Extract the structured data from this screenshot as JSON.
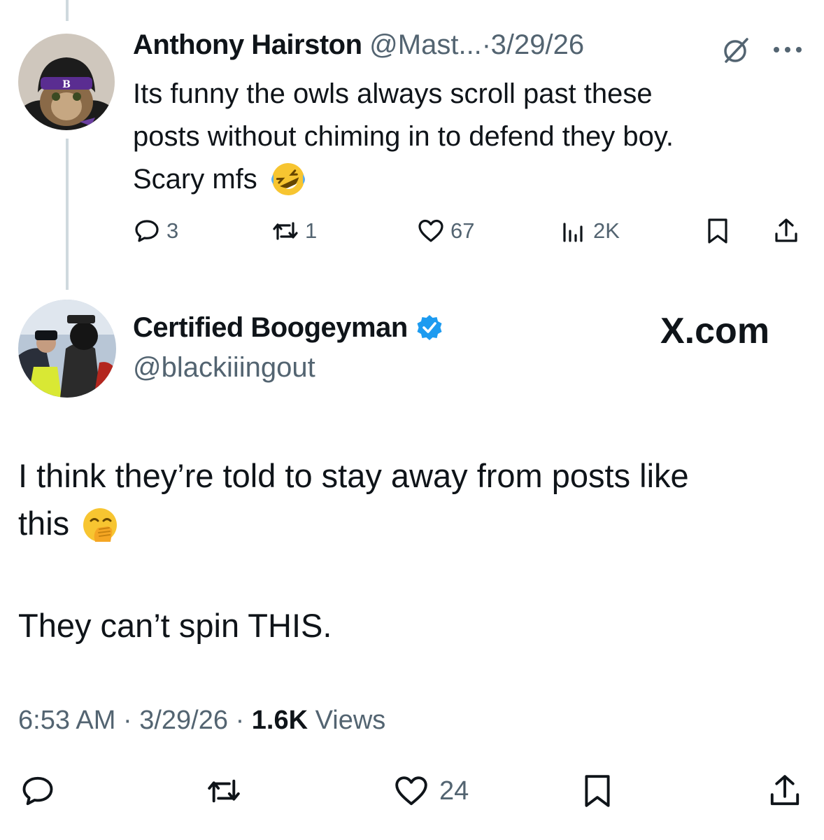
{
  "reply": {
    "author_name": "Anthony Hairston",
    "handle": "@Mast...",
    "separator": "·",
    "date": "3/29/26",
    "text_line1": "Its funny the owls always scroll past these",
    "text_line2": "posts without chiming in to defend they boy.",
    "text_line3": "Scary mfs",
    "emoji": "rolling-on-floor-laughing",
    "stats": {
      "replies": "3",
      "reposts": "1",
      "likes": "67",
      "views": "2K"
    }
  },
  "post": {
    "author_name": "Certified Boogeyman",
    "handle": "@blackiiingout",
    "brand": "X.com",
    "verified_color": "#1d9bf0",
    "text_line1": "I think they’re told to stay away from posts like",
    "text_line2": "this",
    "emoji": "face-with-hand-over-mouth",
    "text_line3": "They can’t spin THIS.",
    "time": "6:53 AM",
    "separator": "·",
    "date": "3/29/26",
    "views_count": "1.6K",
    "views_label": "Views",
    "likes": "24"
  },
  "colors": {
    "muted": "#536471",
    "text": "#0f1419",
    "thread_line": "#cfd9de"
  }
}
